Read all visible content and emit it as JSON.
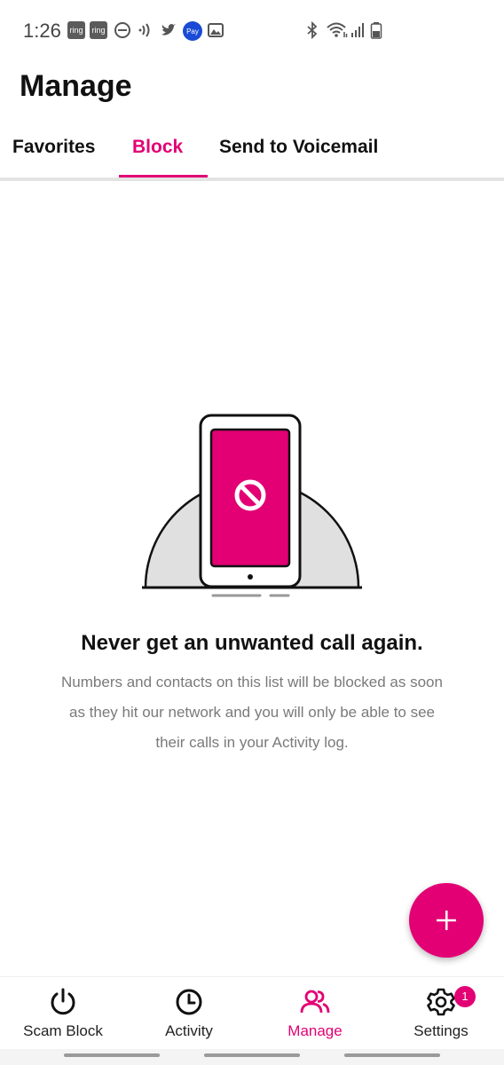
{
  "status_bar": {
    "time": "1:26",
    "ring_label": "ring",
    "pay_label": "Pay"
  },
  "header": {
    "title": "Manage"
  },
  "tabs": [
    {
      "label": "Favorites",
      "active": false
    },
    {
      "label": "Block",
      "active": true
    },
    {
      "label": "Send to Voicemail",
      "active": false
    }
  ],
  "empty_state": {
    "title": "Never get an unwanted call again.",
    "description": "Numbers and contacts on this list will be blocked as soon as they hit our network and you will only be able to see their calls in your Activity log."
  },
  "fab": {
    "icon": "plus-icon"
  },
  "bottom_nav": {
    "items": [
      {
        "label": "Scam Block",
        "icon": "power-icon",
        "active": false
      },
      {
        "label": "Activity",
        "icon": "clock-icon",
        "active": false
      },
      {
        "label": "Manage",
        "icon": "people-icon",
        "active": true
      },
      {
        "label": "Settings",
        "icon": "gear-icon",
        "active": false,
        "badge": "1"
      }
    ]
  },
  "colors": {
    "accent": "#e20074",
    "text_primary": "#111111",
    "text_secondary": "#7a7a7a",
    "divider": "#e3e3e3"
  }
}
